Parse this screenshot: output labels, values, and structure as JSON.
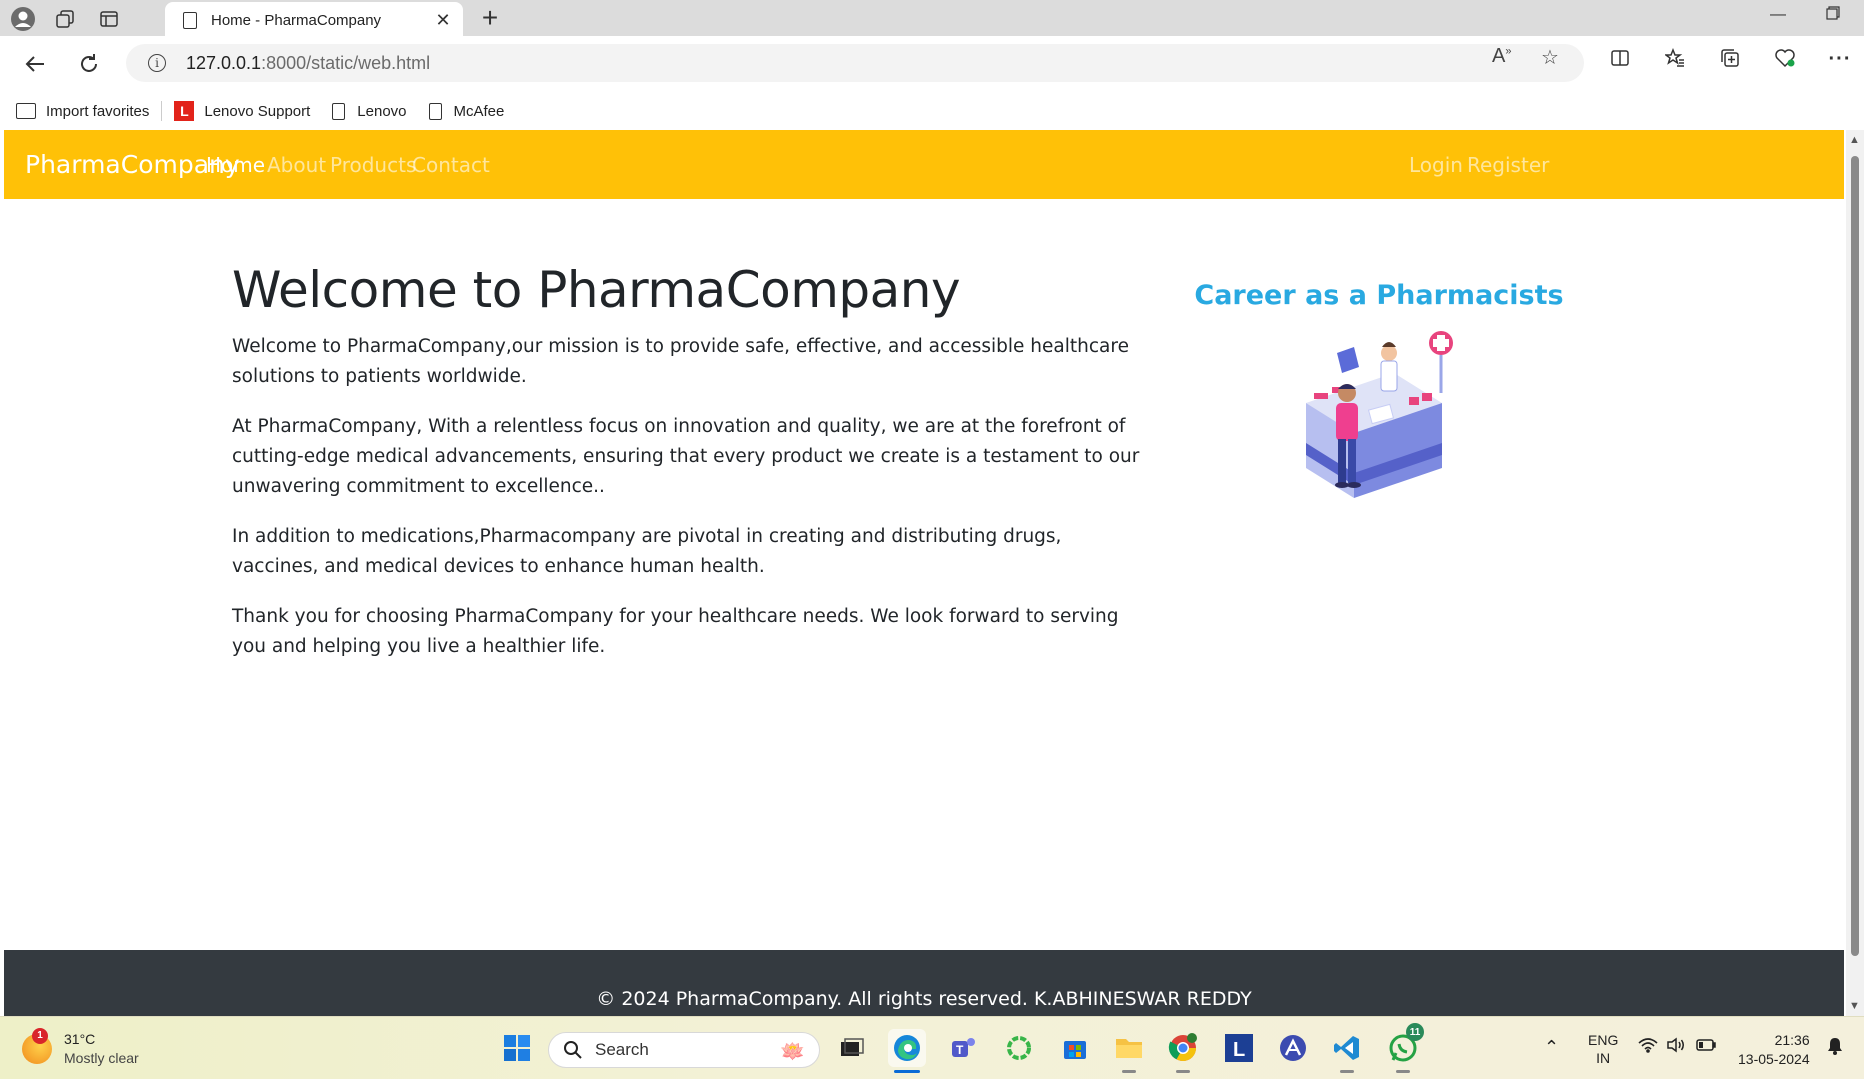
{
  "browser": {
    "tab_title": "Home - PharmaCompany",
    "url_host": "127.0.0.1",
    "url_path": ":8000/static/web.html",
    "favorites": [
      {
        "label": "Import favorites",
        "icon": "import-icon"
      },
      {
        "label": "Lenovo Support",
        "icon": "lenovo-logo-icon"
      },
      {
        "label": "Lenovo",
        "icon": "page-icon"
      },
      {
        "label": "McAfee",
        "icon": "page-icon"
      }
    ]
  },
  "site": {
    "brand": "PharmaCompany",
    "nav": [
      "Home",
      "About",
      "Products",
      "Contact"
    ],
    "nav_right": [
      "Login",
      "Register"
    ],
    "accent_color": "#ffc107"
  },
  "main": {
    "heading": "Welcome to PharmaCompany",
    "paragraphs": [
      "Welcome to PharmaCompany,our mission is to provide safe, effective, and accessible healthcare solutions to patients worldwide.",
      "At PharmaCompany, With a relentless focus on innovation and quality, we are at the forefront of cutting-edge medical advancements, ensuring that every product we create is a testament to our unwavering commitment to excellence..",
      "In addition to medications,Pharmacompany are pivotal in creating and distributing drugs, vaccines, and medical devices to enhance human health.",
      "Thank you for choosing PharmaCompany for your healthcare needs. We look forward to serving you and helping you live a healthier life."
    ],
    "image_title": "Career as a Pharmacists"
  },
  "footer": {
    "text": "© 2024 PharmaCompany. All rights reserved. K.ABHINESWAR REDDY"
  },
  "taskbar": {
    "weather_temp": "31°C",
    "weather_desc": "Mostly clear",
    "weather_badge": "1",
    "search_label": "Search",
    "whatsapp_badge": "11",
    "lang_1": "ENG",
    "lang_2": "IN",
    "time": "21:36",
    "date": "13-05-2024"
  }
}
